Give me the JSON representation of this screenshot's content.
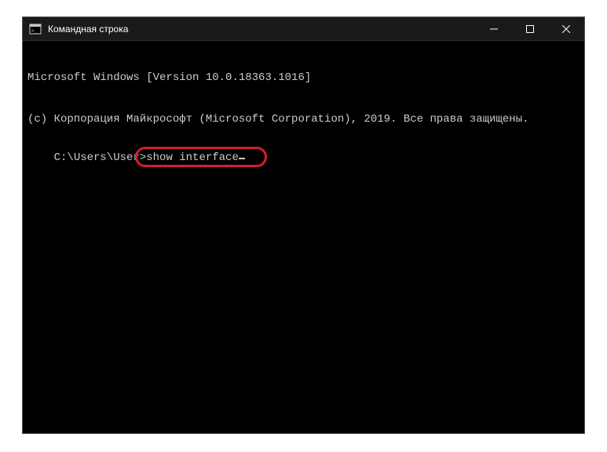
{
  "window": {
    "title": "Командная строка"
  },
  "terminal": {
    "line1": "Microsoft Windows [Version 10.0.18363.1016]",
    "line2": "(c) Корпорация Майкрософт (Microsoft Corporation), 2019. Все права защищены.",
    "prompt": "C:\\Users\\User>",
    "command": "show interface"
  }
}
